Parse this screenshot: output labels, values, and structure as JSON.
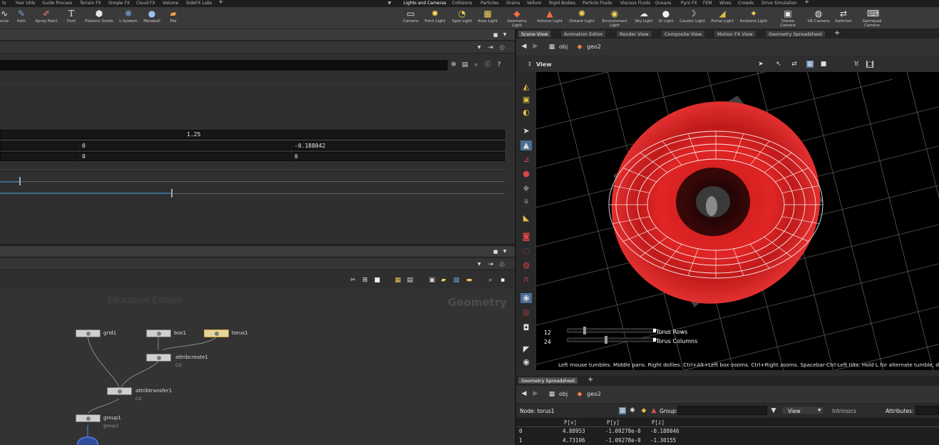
{
  "shelf_tabs_left": [
    "ts",
    "Hair Utils",
    "Guide Process",
    "Terrain FX",
    "Simple FX",
    "Cloud FX",
    "Volume",
    "SideFX Labs"
  ],
  "shelf_tabs_right": [
    "Lights and Cameras",
    "Collisions",
    "Particles",
    "Grains",
    "Vellum",
    "Rigid Bodies",
    "Particle Fluids",
    "Viscous Fluids",
    "Oceans",
    "Pyro FX",
    "FEM",
    "Wires",
    "Crowds",
    "Drive Simulation"
  ],
  "tools_left": [
    {
      "label": "urve",
      "icon": "curve-icon"
    },
    {
      "label": "Path",
      "icon": "path-icon"
    },
    {
      "label": "Spray Paint",
      "icon": "spray-paint-icon"
    },
    {
      "label": "Font",
      "icon": "font-icon"
    },
    {
      "label": "Platonic Solids",
      "icon": "platonic-icon"
    },
    {
      "label": "L-System",
      "icon": "lsystem-icon"
    },
    {
      "label": "Metaball",
      "icon": "metaball-icon"
    },
    {
      "label": "File",
      "icon": "file-icon"
    }
  ],
  "tools_right": [
    {
      "label": "Camera"
    },
    {
      "label": "Point Light"
    },
    {
      "label": "Spot Light"
    },
    {
      "label": "Area Light"
    },
    {
      "label": "Geometry Light"
    },
    {
      "label": "Volume Light"
    },
    {
      "label": "Distant Light"
    },
    {
      "label": "Environment Light"
    },
    {
      "label": "Sky Light"
    },
    {
      "label": "GI Light"
    },
    {
      "label": "Caustic Light"
    },
    {
      "label": "Portal Light"
    },
    {
      "label": "Ambient Light"
    },
    {
      "label": "Stereo Camera"
    },
    {
      "label": "VR Camera"
    },
    {
      "label": "Switcher"
    },
    {
      "label": "Gamepad Camera"
    }
  ],
  "params": {
    "value_a": "1.25",
    "row1_mid": "0",
    "row1_right": "-0.188042",
    "row2_mid": "0",
    "row2_right": "0",
    "slider1_pos": 0.04,
    "slider2_pos": 0.34
  },
  "network": {
    "watermark": "Education Edition",
    "context_label": "Geometry",
    "nodes": [
      {
        "name": "grid1",
        "sub": ""
      },
      {
        "name": "box1",
        "sub": ""
      },
      {
        "name": "torus1",
        "sub": ""
      },
      {
        "name": "attribcreate1",
        "sub": "Cd"
      },
      {
        "name": "attribtransfer1",
        "sub": "Cd"
      },
      {
        "name": "group1",
        "sub": "group1"
      }
    ]
  },
  "pane_tabs": [
    "Scene View",
    "Animation Editor",
    "Render View",
    "Composite View",
    "Motion FX View",
    "Geometry Spreadsheet"
  ],
  "path": {
    "root": "obj",
    "node": "geo2"
  },
  "viewport": {
    "label": "View",
    "slider_rows_value": "12",
    "slider_rows_label": "Torus Rows",
    "slider_cols_value": "24",
    "slider_cols_label": "Torus Columns",
    "hint": "Left mouse tumbles. Middle pans. Right dollies. Ctrl+Alt+Left box-zooms. Ctrl+Right zooms. Spacebar-Ctrl-Left tilts. Hold L for alternate tumble, dolly, a"
  },
  "spreadsheet": {
    "tab": "Geometry Spreadsheet",
    "node_label": "Node: torus1",
    "group_label": "Group:",
    "view_label": "View",
    "intrinsics_label": "Intrinsics",
    "attributes_label": "Attributes:",
    "columns": [
      "",
      "P[x]",
      "P[y]",
      "P[z]"
    ],
    "rows": [
      [
        "0",
        "4.88953",
        "-1.09278e-0",
        "-0.188046"
      ],
      [
        "1",
        "4.73106",
        "-1.09278e-0",
        "-1.30155"
      ]
    ]
  },
  "colors": {
    "accent": "#e8c66a",
    "torus_red": "#d81f1f",
    "viewport_bg": "#000000"
  }
}
